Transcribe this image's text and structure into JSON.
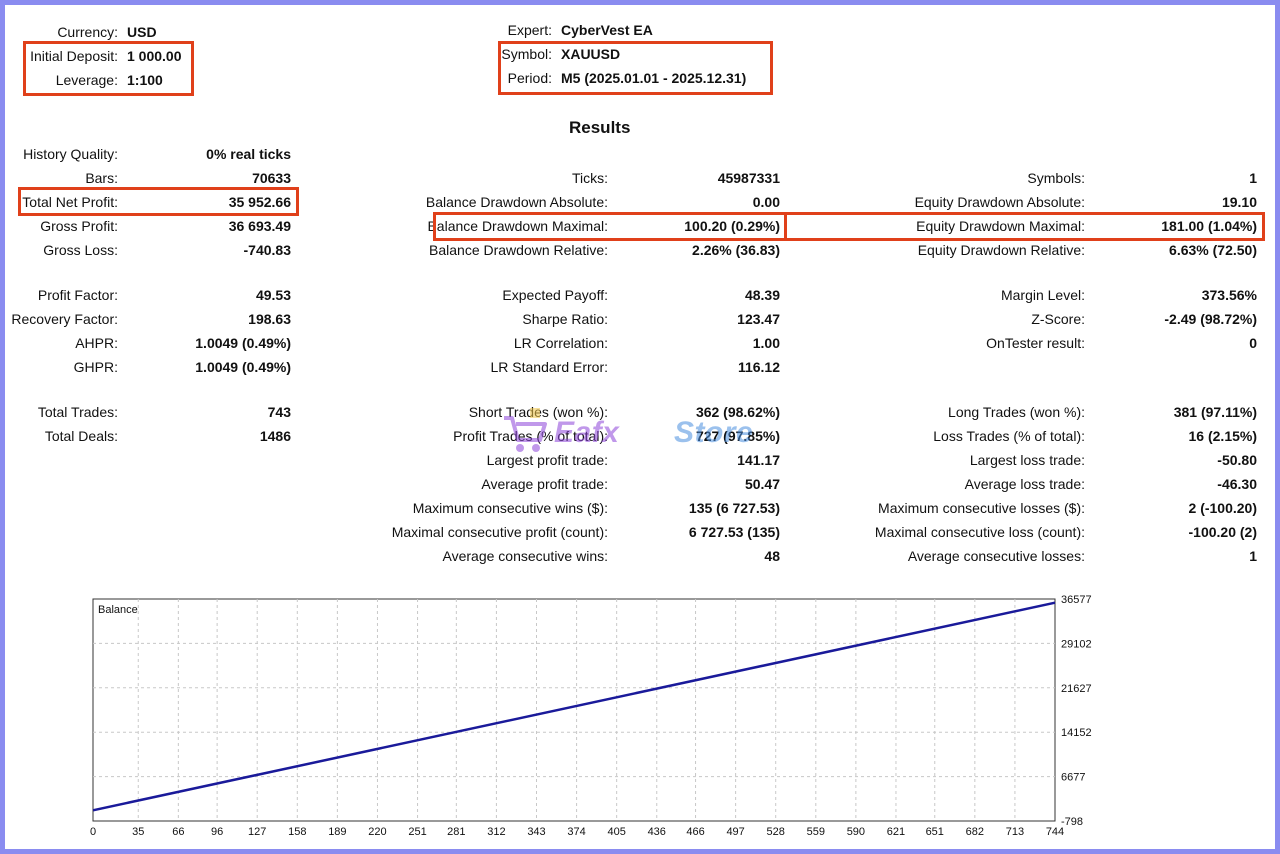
{
  "header": {
    "currency_label": "Currency:",
    "currency_value": "USD",
    "deposit_label": "Initial Deposit:",
    "deposit_value": "1 000.00",
    "leverage_label": "Leverage:",
    "leverage_value": "1:100",
    "expert_label": "Expert:",
    "expert_value": "CyberVest EA",
    "symbol_label": "Symbol:",
    "symbol_value": "XAUUSD",
    "period_label": "Period:",
    "period_value": "M5 (2025.01.01 - 2025.12.31)"
  },
  "results_title": "Results",
  "col1": [
    {
      "label": "History Quality:",
      "value": "0% real ticks"
    },
    {
      "label": "Bars:",
      "value": "70633"
    },
    {
      "label": "Total Net Profit:",
      "value": "35 952.66"
    },
    {
      "label": "Gross Profit:",
      "value": "36 693.49"
    },
    {
      "label": "Gross Loss:",
      "value": "-740.83"
    },
    {
      "label": "Profit Factor:",
      "value": "49.53"
    },
    {
      "label": "Recovery Factor:",
      "value": "198.63"
    },
    {
      "label": "AHPR:",
      "value": "1.0049 (0.49%)"
    },
    {
      "label": "GHPR:",
      "value": "1.0049 (0.49%)"
    },
    {
      "label": "Total Trades:",
      "value": "743"
    },
    {
      "label": "Total Deals:",
      "value": "1486"
    }
  ],
  "col2": [
    {
      "label": "Ticks:",
      "value": "45987331"
    },
    {
      "label": "Balance Drawdown Absolute:",
      "value": "0.00"
    },
    {
      "label": "Balance Drawdown Maximal:",
      "value": "100.20 (0.29%)"
    },
    {
      "label": "Balance Drawdown Relative:",
      "value": "2.26% (36.83)"
    },
    {
      "label": "Expected Payoff:",
      "value": "48.39"
    },
    {
      "label": "Sharpe Ratio:",
      "value": "123.47"
    },
    {
      "label": "LR Correlation:",
      "value": "1.00"
    },
    {
      "label": "LR Standard Error:",
      "value": "116.12"
    },
    {
      "label": "Short Trades (won %):",
      "value": "362 (98.62%)"
    },
    {
      "label": "Profit Trades (% of total):",
      "value": "727 (97.85%)"
    },
    {
      "label": "Largest profit trade:",
      "value": "141.17"
    },
    {
      "label": "Average profit trade:",
      "value": "50.47"
    },
    {
      "label": "Maximum consecutive wins ($):",
      "value": "135 (6 727.53)"
    },
    {
      "label": "Maximal consecutive profit (count):",
      "value": "6 727.53 (135)"
    },
    {
      "label": "Average consecutive wins:",
      "value": "48"
    }
  ],
  "col3": [
    {
      "label": "Symbols:",
      "value": "1"
    },
    {
      "label": "Equity Drawdown Absolute:",
      "value": "19.10"
    },
    {
      "label": "Equity Drawdown Maximal:",
      "value": "181.00 (1.04%)"
    },
    {
      "label": "Equity Drawdown Relative:",
      "value": "6.63% (72.50)"
    },
    {
      "label": "Margin Level:",
      "value": "373.56%"
    },
    {
      "label": "Z-Score:",
      "value": "-2.49 (98.72%)"
    },
    {
      "label": "OnTester result:",
      "value": "0"
    },
    {
      "label": "Long Trades (won %):",
      "value": "381 (97.11%)"
    },
    {
      "label": "Loss Trades (% of total):",
      "value": "16 (2.15%)"
    },
    {
      "label": "Largest loss trade:",
      "value": "-50.80"
    },
    {
      "label": "Average loss trade:",
      "value": "-46.30"
    },
    {
      "label": "Maximum consecutive losses ($):",
      "value": "2 (-100.20)"
    },
    {
      "label": "Maximal consecutive loss (count):",
      "value": "-100.20 (2)"
    },
    {
      "label": "Average consecutive losses:",
      "value": "1"
    }
  ],
  "watermark": {
    "part1": "Eafx",
    "part2": "Store"
  },
  "colors": {
    "highlight": "#e0401a",
    "line": "#1a1a9a",
    "frame": "#8a8cf0",
    "wm1": "#8e44d9",
    "wm2": "#4a8fe0"
  },
  "chart_data": {
    "type": "line",
    "legend": "Balance",
    "x_ticks": [
      "0",
      "35",
      "66",
      "96",
      "127",
      "158",
      "189",
      "220",
      "251",
      "281",
      "312",
      "343",
      "374",
      "405",
      "436",
      "466",
      "497",
      "528",
      "559",
      "590",
      "621",
      "651",
      "682",
      "713",
      "744"
    ],
    "y_ticks": [
      "36577",
      "29102",
      "21627",
      "14152",
      "6677",
      "-798"
    ],
    "xlim": [
      0,
      744
    ],
    "ylim": [
      -798,
      36577
    ],
    "grid": true,
    "series": [
      {
        "values_x": [
          0,
          744
        ],
        "values_y": [
          1000,
          35952.66
        ]
      }
    ]
  }
}
